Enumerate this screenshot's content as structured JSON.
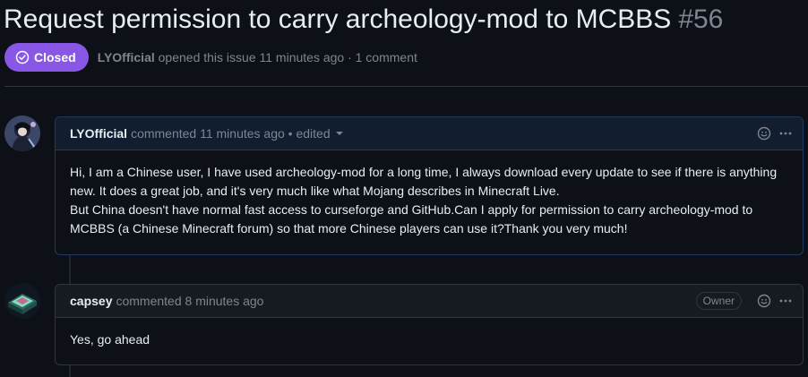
{
  "issue": {
    "title": "Request permission to carry archeology-mod to MCBBS",
    "number": "#56",
    "state": "Closed",
    "author": "LYOfficial",
    "opened_text": "opened this issue 11 minutes ago · 1 comment"
  },
  "comments": [
    {
      "author": "LYOfficial",
      "meta": "commented 11 minutes ago • edited",
      "paragraphs": [
        "Hi, I am a Chinese user, I have used archeology-mod for a long time, I always download every update to see if there is anything new. It does a great job, and it's very much like what Mojang describes in Minecraft Live.",
        "But China doesn't have normal fast access to curseforge and GitHub.Can I apply for permission to carry archeology-mod to MCBBS (a Chinese Minecraft forum) so that more Chinese players can use it?Thank you very much!"
      ]
    },
    {
      "author": "capsey",
      "meta": "commented 8 minutes ago",
      "role": "Owner",
      "paragraphs": [
        "Yes, go ahead"
      ]
    }
  ],
  "icons": {
    "state": "circle-check-icon",
    "reaction": "smiley-icon",
    "more": "kebab-horizontal-icon",
    "edited_menu": "triangle-down-icon"
  },
  "colors": {
    "background": "#0d1117",
    "closed_badge": "#8957e5",
    "border": "#30363d",
    "muted_text": "#7d8590",
    "highlight_header": "#121d2f"
  }
}
